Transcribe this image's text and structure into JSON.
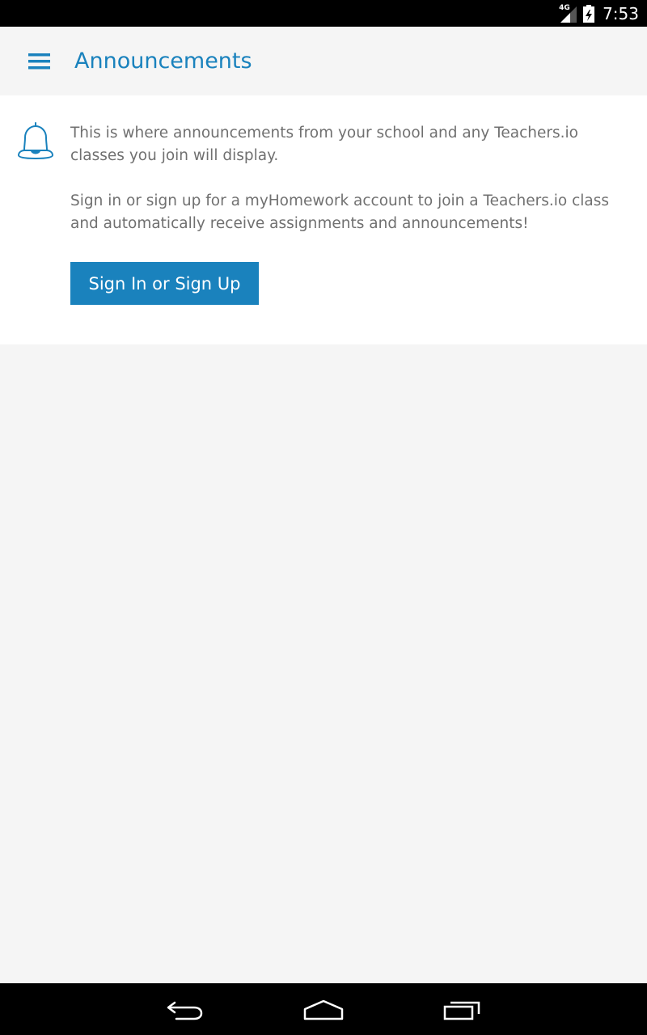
{
  "status_bar": {
    "network": "4G",
    "time": "7:53"
  },
  "app_bar": {
    "title": "Announcements",
    "menu_icon": "hamburger-menu-icon"
  },
  "announcements": {
    "icon": "bell-icon",
    "message_1": "This is where announcements from your school and any Teachers.io classes you join will display.",
    "message_2": "Sign in or sign up for a myHomework account to join a Teachers.io class and automatically receive assignments and announcements!",
    "button_label": "Sign In or Sign Up"
  },
  "nav_bar": {
    "icons": [
      "back-icon",
      "home-icon",
      "recent-apps-icon"
    ]
  },
  "colors": {
    "accent": "#1a82bd",
    "background": "#f5f5f5",
    "card": "#ffffff",
    "body_text": "#707070"
  }
}
